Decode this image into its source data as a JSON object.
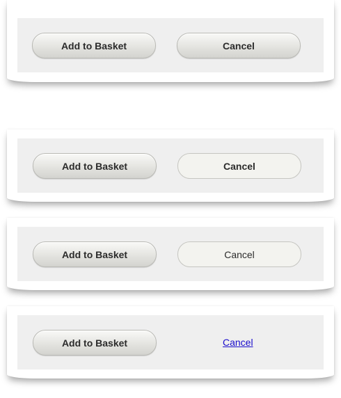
{
  "variants": [
    {
      "primary_label": "Add to Basket",
      "secondary_label": "Cancel"
    },
    {
      "primary_label": "Add to Basket",
      "secondary_label": "Cancel"
    },
    {
      "primary_label": "Add to Basket",
      "secondary_label": "Cancel"
    },
    {
      "primary_label": "Add to Basket",
      "secondary_label": "Cancel"
    }
  ],
  "colors": {
    "panel_background": "#efefef",
    "link": "#1a0dcc",
    "text": "#2b2b2b"
  }
}
